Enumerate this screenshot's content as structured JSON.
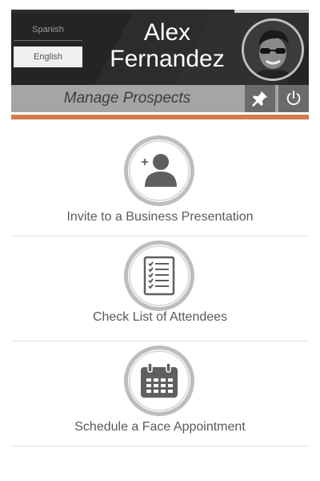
{
  "header": {
    "languages": [
      "Spanish",
      "English"
    ],
    "selected_language": "English",
    "user_name": "Alex Fernandez",
    "progress": 0.25
  },
  "subbar": {
    "title": "Manage Prospects"
  },
  "menu": {
    "items": [
      {
        "label": "Invite to a Business Presentation",
        "icon": "add-user-icon"
      },
      {
        "label": "Check List of Attendees",
        "icon": "checklist-icon"
      },
      {
        "label": "Schedule a Face Appointment",
        "icon": "calendar-icon"
      }
    ]
  },
  "colors": {
    "header_bg": "#242424",
    "subbar_bg": "#a5a5a5",
    "accent": "#d27c4a",
    "icon": "#5f5f5f"
  }
}
